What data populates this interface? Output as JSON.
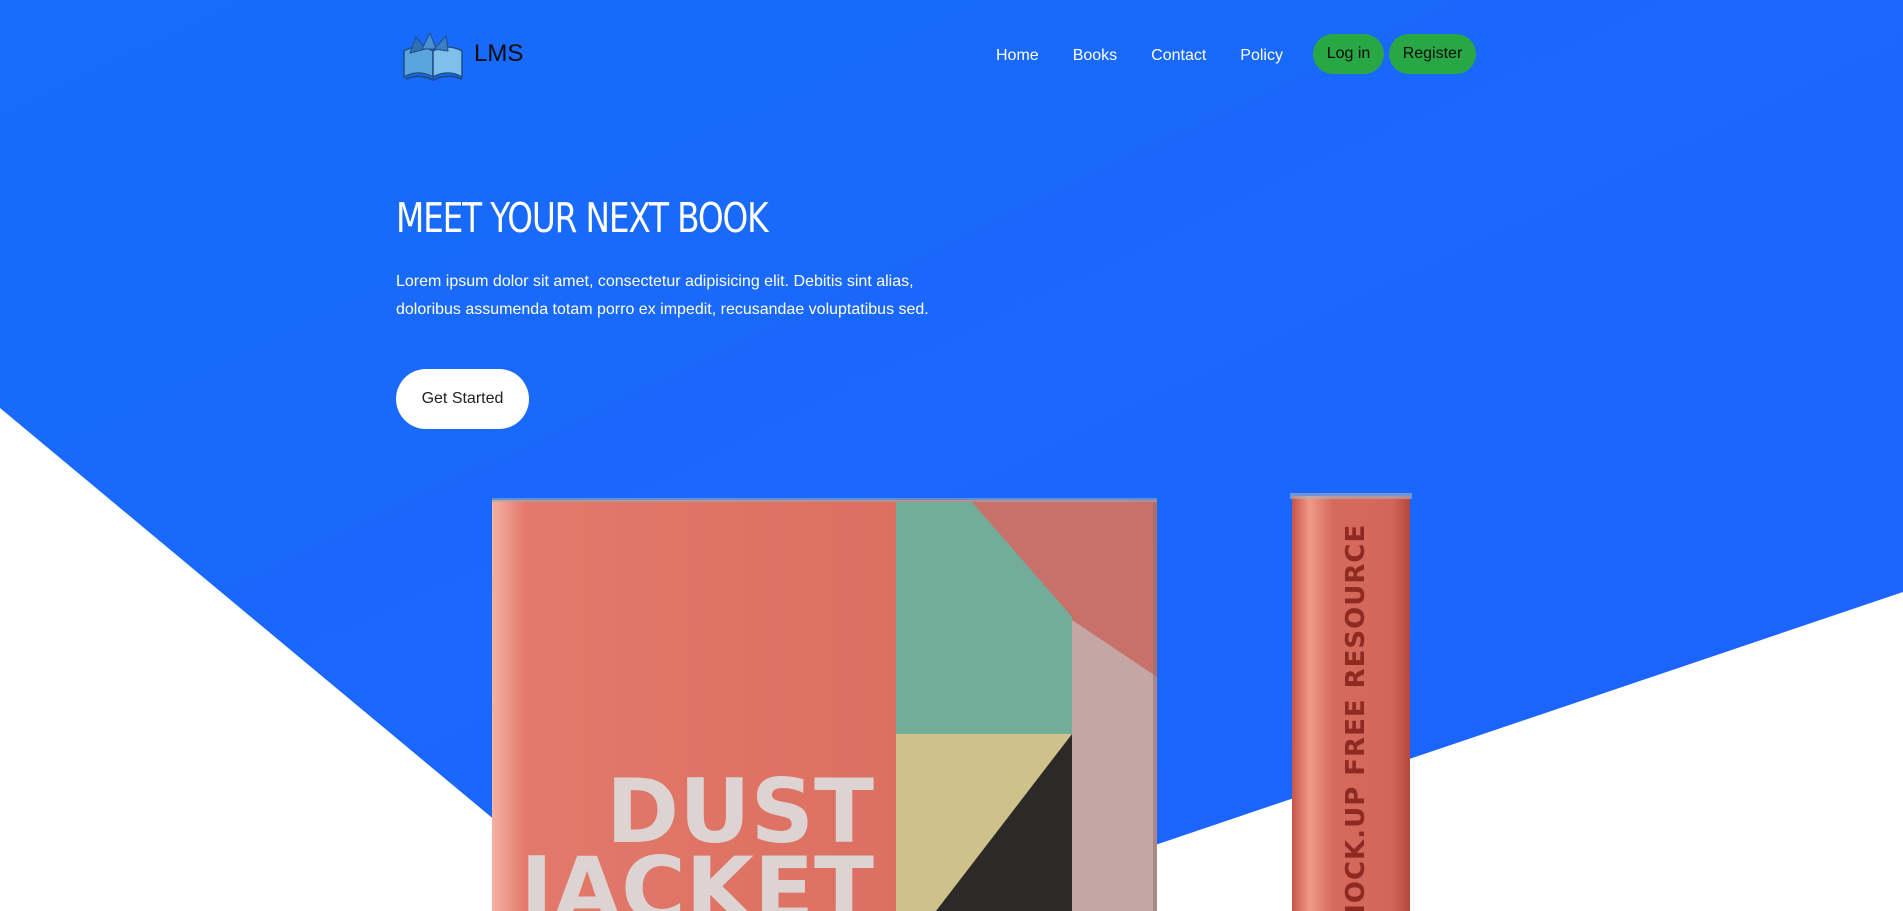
{
  "brand": {
    "name": "LMS",
    "logo_icon": "open-book-icon"
  },
  "nav": {
    "links": [
      {
        "label": "Home"
      },
      {
        "label": "Books"
      },
      {
        "label": "Contact"
      },
      {
        "label": "Policy"
      }
    ],
    "login_label": "Log in",
    "register_label": "Register"
  },
  "hero": {
    "title": "MEET YOUR NEXT BOOK",
    "text": "Lorem ipsum dolor sit amet, consectetur adipisicing elit. Debitis sint alias, doloribus assumenda totam porro ex impedit, recusandae voluptatibus sed.",
    "cta_label": "Get Started"
  },
  "book_image": {
    "cover_line1": "DUST",
    "cover_line2": "JACKET",
    "spine_text": "MOCK.UP FREE RESOURCE"
  },
  "colors": {
    "hero_blue": "#1a6dfb",
    "button_green": "#28a745",
    "book_coral": "#d9695b"
  }
}
